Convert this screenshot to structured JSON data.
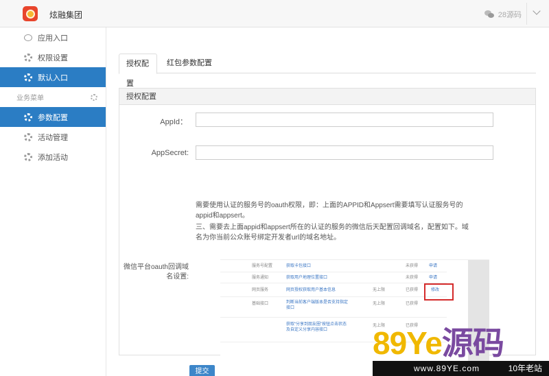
{
  "app": {
    "title": "炫融集团",
    "user_label": "28源码"
  },
  "sidebar": {
    "items_top": [
      {
        "label": "应用入口",
        "icon": "chat-bubble-icon",
        "active": false
      },
      {
        "label": "权限设置",
        "icon": "gear-icon",
        "active": false
      },
      {
        "label": "默认入口",
        "icon": "gear-icon",
        "active": true
      }
    ],
    "section_label": "业务菜单",
    "items_bottom": [
      {
        "label": "参数配置",
        "icon": "gear-icon",
        "active": true
      },
      {
        "label": "活动管理",
        "icon": "gear-icon",
        "active": false
      },
      {
        "label": "添加活动",
        "icon": "gear-icon",
        "active": false
      }
    ]
  },
  "tabs": [
    {
      "label": "授权配置",
      "active": true
    },
    {
      "label": "红包参数配置",
      "active": false
    }
  ],
  "panel": {
    "title": "授权配置",
    "appid_label": "AppId：",
    "appid_value": "",
    "appsecret_label": "AppSecret:",
    "appsecret_value": "",
    "help_1": "需要使用认证的服务号的oauth权限，即：上面的APPID和Appsert需要填写认证服务号的appid和appsert。",
    "help_2": "三、需要去上面appid和appsert所在的认证的服务的微信后天配置回调域名，配置如下。域名为你当前公众账号绑定开发者url的域名地址。",
    "callback_label": "微信平台oauth回调域名设置:",
    "embedded_screenshot": {
      "rows": [
        {
          "c1": "服务号配置",
          "c2": "获取卡包接口",
          "c3": "",
          "c4": "未获得",
          "c5": "申请"
        },
        {
          "c1": "服务通知",
          "c2": "获取用户地理位置接口",
          "c3": "",
          "c4": "未获得",
          "c5": "申请"
        },
        {
          "c1": "网页服务",
          "c2": "网页授权获取用户基本信息",
          "c3": "无上限",
          "c4": "已获得",
          "c5": "修改"
        },
        {
          "c1": "基础接口",
          "c2": "判断当前客户端版本是否支持指定接口",
          "c3": "无上限",
          "c4": "已获得",
          "c5": ""
        },
        {
          "c1": "",
          "c2": "获取“分享到朋友圈”按钮点击状态及自定义分享内容接口",
          "c3": "无上限",
          "c4": "已获得",
          "c5": ""
        }
      ]
    }
  },
  "submit_label": "提交",
  "watermark": {
    "brand": "89Ye",
    "brand_cn": "源码",
    "url": "www.89YE.com",
    "tagline": "10年老站"
  }
}
